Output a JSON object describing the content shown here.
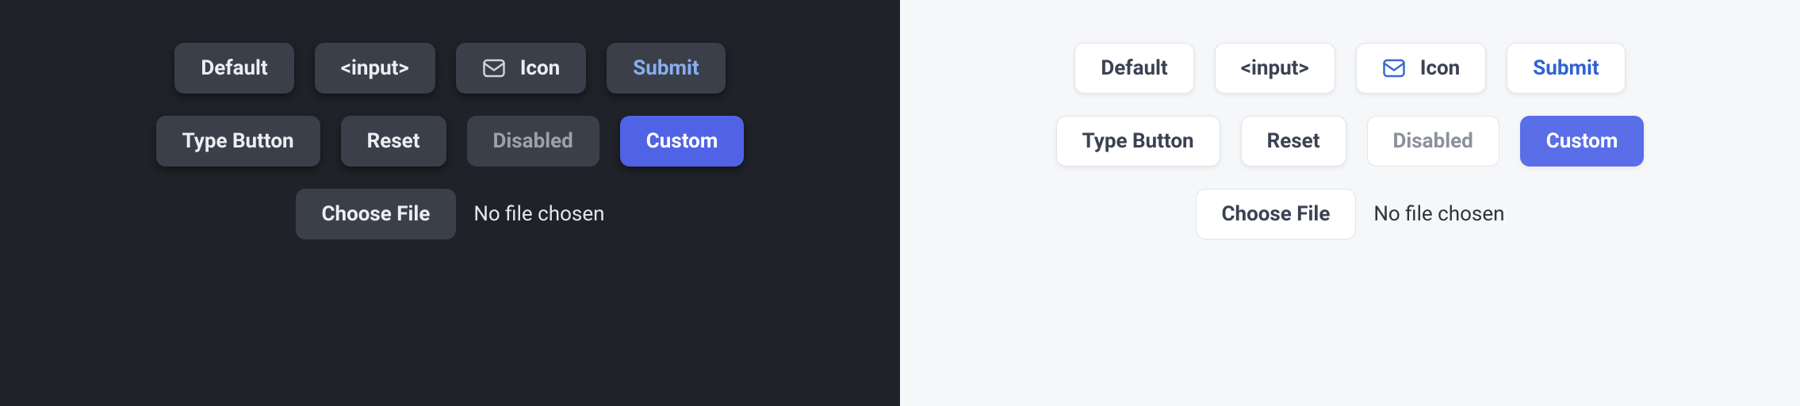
{
  "buttons": {
    "default": "Default",
    "input": "<input>",
    "icon": "Icon",
    "submit": "Submit",
    "typebtn": "Type Button",
    "reset": "Reset",
    "disabled": "Disabled",
    "custom": "Custom",
    "choose": "Choose File"
  },
  "file_status": "No file chosen",
  "icons": {
    "mail": "mail-icon"
  },
  "themes": [
    "dark",
    "light"
  ],
  "colors": {
    "dark_bg": "#1f2228",
    "light_bg": "#f6f7f9",
    "dark_button_bg": "#3a3f49",
    "light_button_bg": "#ffffff",
    "accent": "#5062e6",
    "submit_dark": "#8aaef0",
    "submit_light": "#2f63d4"
  }
}
